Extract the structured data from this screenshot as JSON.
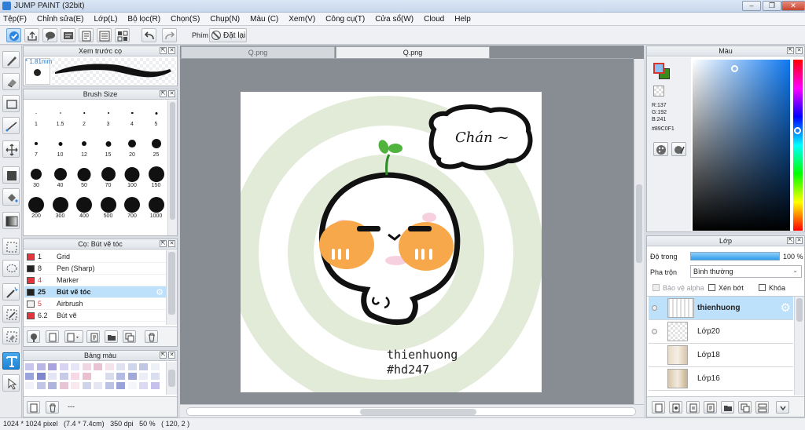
{
  "window": {
    "title": "JUMP PAINT (32bit)",
    "minimize": "–",
    "restore": "❐",
    "close": "✕"
  },
  "menu": [
    "Tệp(F)",
    "Chỉnh sửa(E)",
    "Lớp(L)",
    "Bộ lọc(R)",
    "Chọn(S)",
    "Chụp(N)",
    "Màu (C)",
    "Xem(V)",
    "Công cụ(T)",
    "Cửa sổ(W)",
    "Cloud",
    "Help"
  ],
  "toolbar": {
    "phim_label": "Phím",
    "reset_label": "Đặt lại"
  },
  "brush_preview": {
    "title": "Xem trước cọ",
    "size": "* 1.81mm"
  },
  "brush_size": {
    "title": "Brush Size",
    "sizes": [
      "1",
      "1.5",
      "2",
      "3",
      "4",
      "5",
      "7",
      "10",
      "12",
      "15",
      "20",
      "25",
      "30",
      "40",
      "50",
      "70",
      "100",
      "150",
      "200",
      "300",
      "400",
      "500",
      "700",
      "1000"
    ]
  },
  "brush_list": {
    "title": "Cọ: Bút vẽ tóc",
    "items": [
      {
        "num": "1",
        "name": "Grid",
        "color": "#e5343d"
      },
      {
        "num": "8",
        "name": "Pen (Sharp)",
        "color": "#222222"
      },
      {
        "num": "4",
        "name": "Marker",
        "color": "#e5343d"
      },
      {
        "num": "25",
        "name": "Bút vẽ tóc",
        "color": "#222222"
      },
      {
        "num": "5",
        "name": "Airbrush",
        "color": "#f2f2f2"
      },
      {
        "num": "6.2",
        "name": "Bút vẽ",
        "color": "#e5343d"
      }
    ]
  },
  "palette": {
    "title": "Bảng màu",
    "footer": "---"
  },
  "canvas": {
    "tabs": [
      "Q.png",
      "Q.png"
    ],
    "speech": "Chán ~",
    "watermark_line1": "thienhuong",
    "watermark_line2": "#hd247"
  },
  "color_panel": {
    "title": "Màu",
    "primary": "#89C0F1",
    "secondary": "#3b8a1e",
    "r": "R:137",
    "g": "G:192",
    "b": "B:241",
    "hex": "#89C0F1"
  },
  "layer_panel": {
    "title": "Lớp",
    "opacity_label": "Độ trong",
    "opacity_value": "100 %",
    "blend_label": "Pha trộn",
    "blend_value": "Bình thường",
    "protect_alpha": "Bảo vệ alpha",
    "clip": "Xén bớt",
    "lock": "Khóa",
    "layers": [
      "thienhuong",
      "Lớp20",
      "Lớp18",
      "Lớp16"
    ]
  },
  "status": "1024 * 1024 pixel   (7.4 * 7.4cm)   350 dpi   50 %   ( 120, 2 )"
}
